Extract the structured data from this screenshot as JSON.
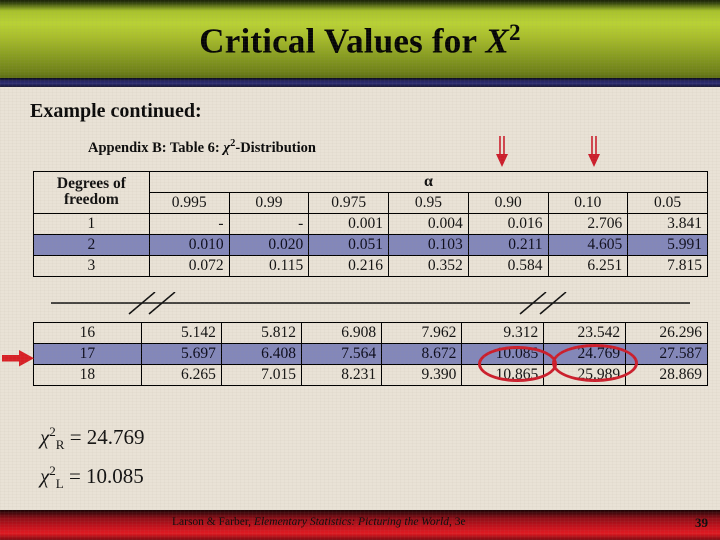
{
  "banner": {
    "title_main": "Critical Values for ",
    "title_var": "X",
    "title_sup": "2"
  },
  "headings": {
    "example": "Example continued:",
    "subtitle_pre": "Appendix B: Table 6: ",
    "subtitle_chi": "χ",
    "subtitle_sup": "2",
    "subtitle_post": "-Distribution"
  },
  "table": {
    "df_header_line1": "Degrees of",
    "df_header_line2": "freedom",
    "alpha_header": "α",
    "columns": [
      "0.995",
      "0.99",
      "0.975",
      "0.95",
      "0.90",
      "0.10",
      "0.05"
    ],
    "rows_top": [
      {
        "df": "1",
        "values": [
          "-",
          "-",
          "0.001",
          "0.004",
          "0.016",
          "2.706",
          "3.841"
        ],
        "highlight": false
      },
      {
        "df": "2",
        "values": [
          "0.010",
          "0.020",
          "0.051",
          "0.103",
          "0.211",
          "4.605",
          "5.991"
        ],
        "highlight": true
      },
      {
        "df": "3",
        "values": [
          "0.072",
          "0.115",
          "0.216",
          "0.352",
          "0.584",
          "6.251",
          "7.815"
        ],
        "highlight": false
      }
    ],
    "rows_bottom": [
      {
        "df": "16",
        "values": [
          "5.142",
          "5.812",
          "6.908",
          "7.962",
          "9.312",
          "23.542",
          "26.296"
        ],
        "highlight": false
      },
      {
        "df": "17",
        "values": [
          "5.697",
          "6.408",
          "7.564",
          "8.672",
          "10.085",
          "24.769",
          "27.587"
        ],
        "highlight": true
      },
      {
        "df": "18",
        "values": [
          "6.265",
          "7.015",
          "8.231",
          "9.390",
          "10.865",
          "25.989",
          "28.869"
        ],
        "highlight": false
      }
    ]
  },
  "annotations": {
    "circled_values": [
      "10.085",
      "24.769"
    ],
    "row_marker_df": "17",
    "down_arrow_columns": [
      "0.90",
      "0.10"
    ]
  },
  "formulas": {
    "chi": "χ",
    "sup": "2",
    "right_sub": "R",
    "right_eq": " = 24.769",
    "left_sub": "L",
    "left_eq": " = 10.085"
  },
  "footer": {
    "authors": "Larson & Farber, ",
    "book_title": "Elementary Statistics: Picturing the World",
    "edition": ", 3e",
    "page_number": "39"
  },
  "colors": {
    "banner_top": "#b9d235",
    "banner_bottom": "#5d6d15",
    "blue_bar": "#2d2d72",
    "highlight_row": "#8387ba",
    "annotation_red": "#cc1d2b",
    "footer_red": "#c8121d",
    "paper": "#e9e2d6"
  }
}
